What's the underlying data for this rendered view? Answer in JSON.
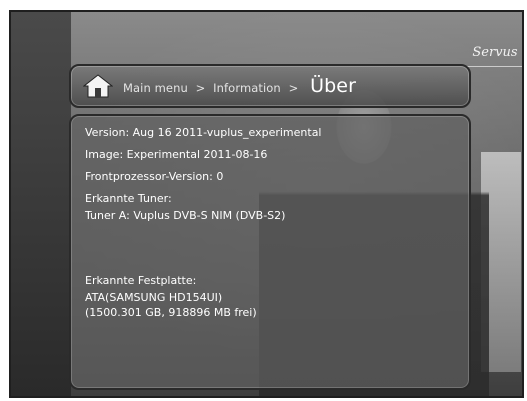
{
  "logo": {
    "text": "Servus"
  },
  "header": {
    "icon": "home-icon",
    "breadcrumb": [
      "Main menu",
      "Information"
    ],
    "separator": ">",
    "current": "Über"
  },
  "info": {
    "version": "Version: Aug 16 2011-vuplus_experimental",
    "image": "Image: Experimental 2011-08-16",
    "frontprocessor": "Frontprozessor-Version: 0",
    "tuner_heading": "Erkannte Tuner:",
    "tuner_a": "Tuner A: Vuplus DVB-S NIM (DVB-S2)",
    "hdd_heading": "Erkannte Festplatte:",
    "hdd_model": "ATA(SAMSUNG HD154UI)",
    "hdd_capacity": "(1500.301 GB, 918896 MB frei)"
  },
  "colors": {
    "text": "#ffffff",
    "panel_border": "#2a2a2a",
    "panel_fill": "#5f5f5f"
  }
}
